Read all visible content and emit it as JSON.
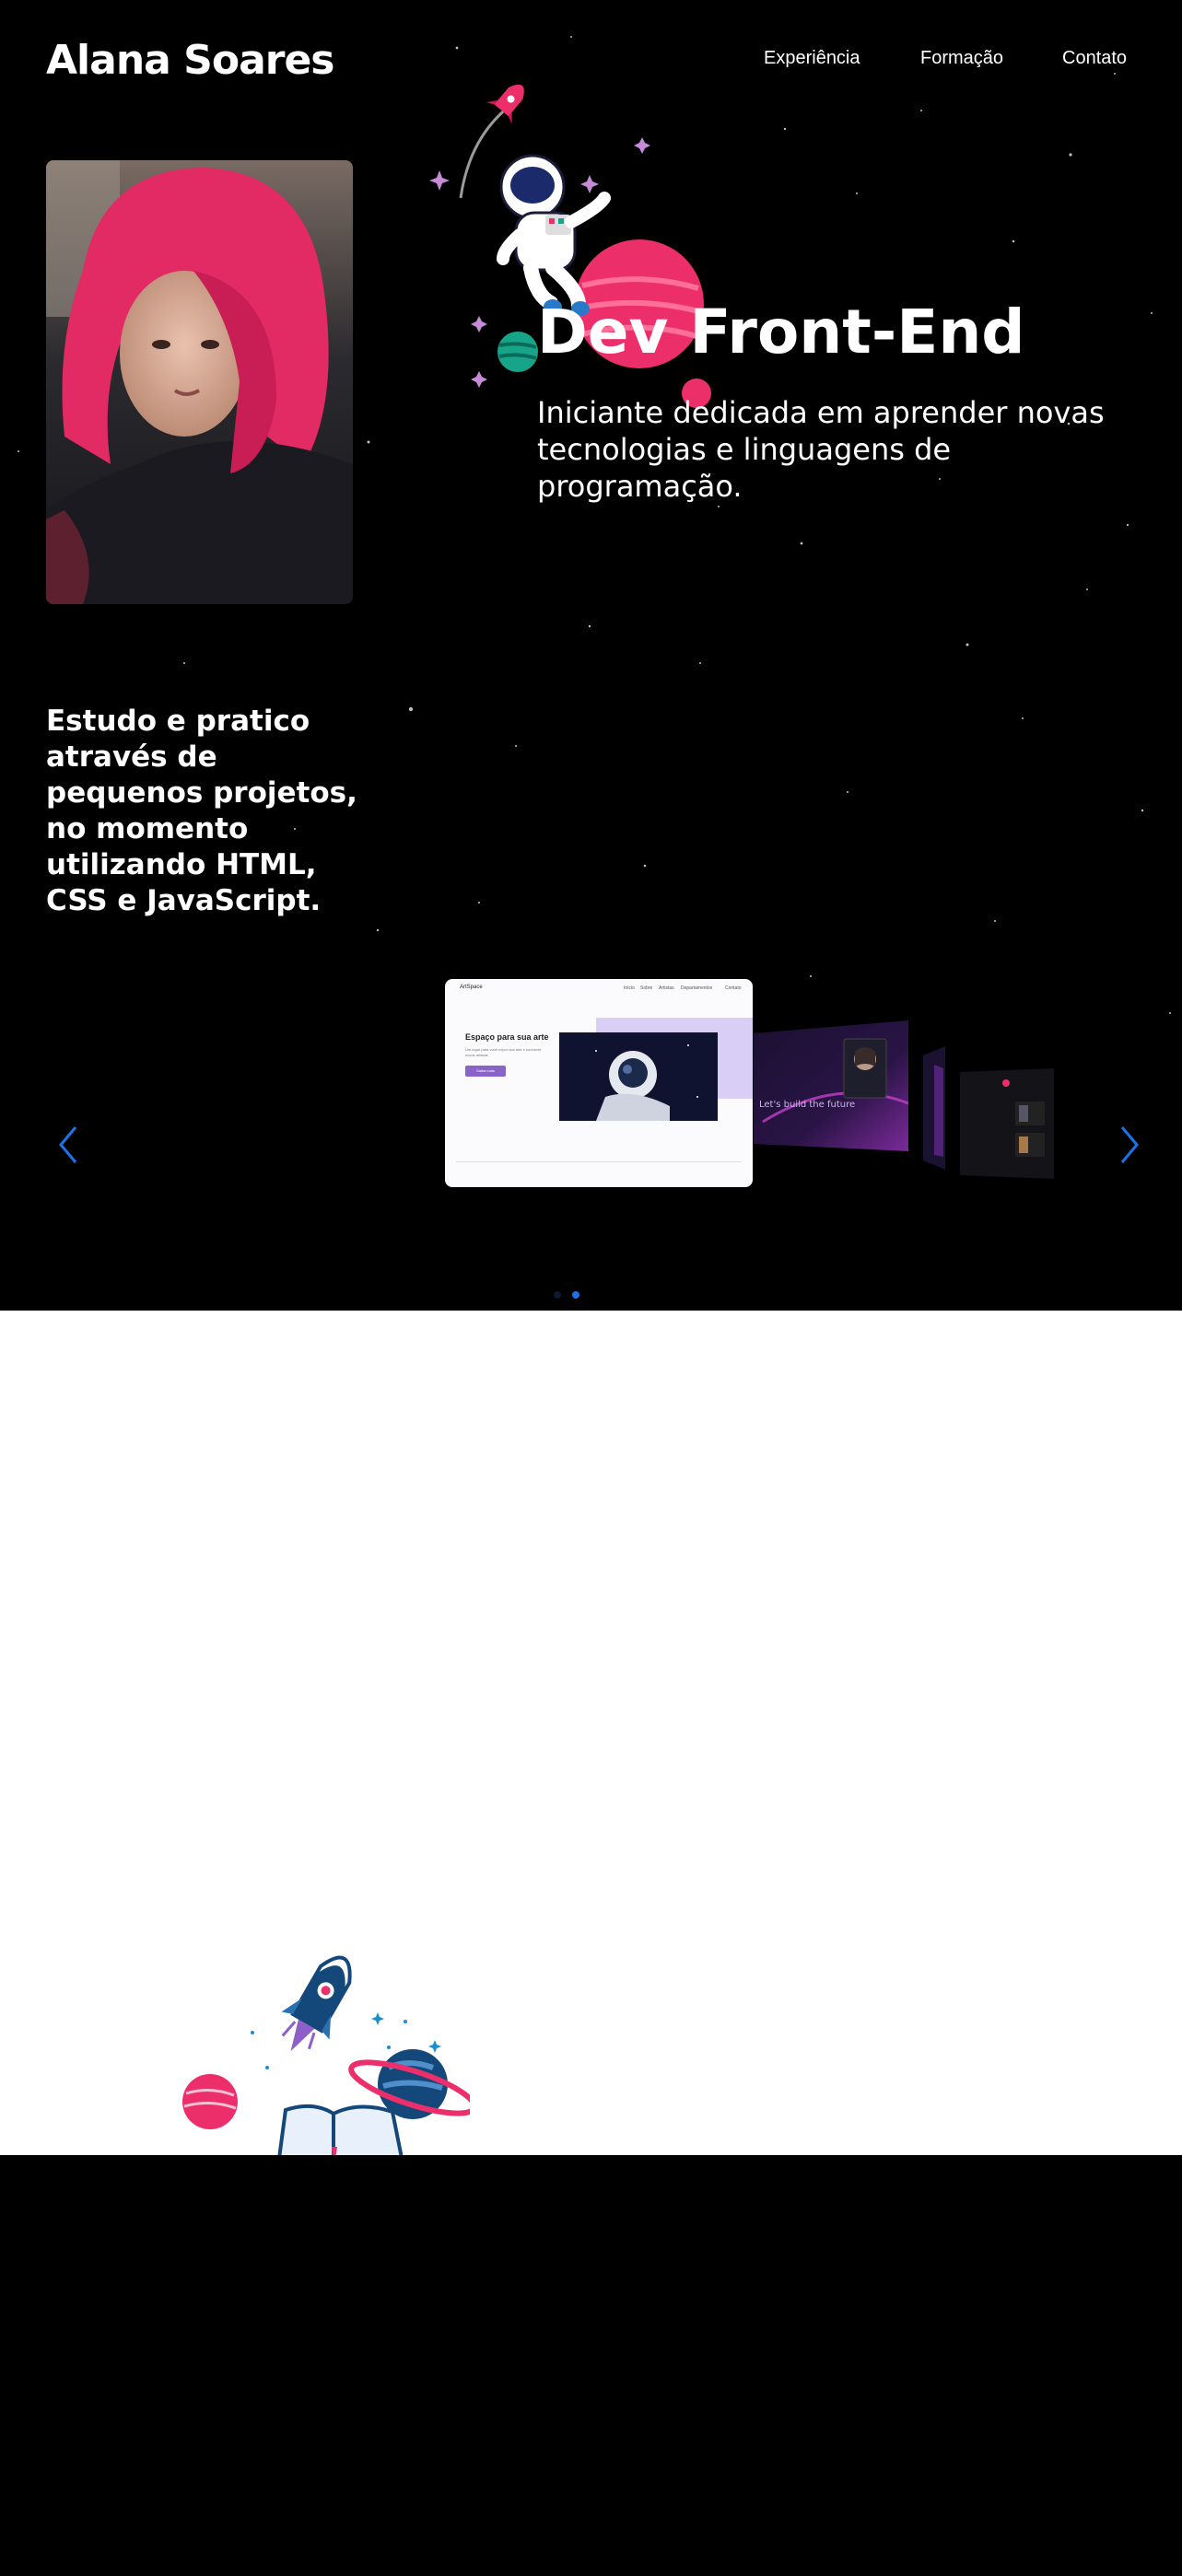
{
  "header": {
    "brand": "Alana Soares",
    "nav": [
      "Experiência",
      "Formação",
      "Contato"
    ]
  },
  "hero": {
    "title": "Dev Front-End",
    "subtitle": "Iniciante dedicada em aprender novas tecnologias e linguagens de programação.",
    "study_text": "Estudo e pratico através de pequenos projetos, no momento utilizando HTML, CSS e JavaScript."
  },
  "carousel": {
    "active_slide": 2,
    "slide_count": 2,
    "main_slide": {
      "logo": "ArtSpace",
      "menu": [
        "Início",
        "Sobre",
        "Artistas",
        "Departamentos",
        "Contato"
      ],
      "heading": "Espaço para sua arte",
      "paragraph": "Um lugar para você expor sua arte e conhecer novos artistas.",
      "button": "Saiba mais"
    },
    "second_slide": {
      "text": "Let's build the future"
    }
  },
  "colors": {
    "accent_blue": "#1a73e8",
    "pink": "#ec2f6b",
    "teal": "#17a58a",
    "navy": "#14487a",
    "background": "#000000"
  },
  "icons": {
    "prev": "chevron-left-icon",
    "next": "chevron-right-icon"
  }
}
